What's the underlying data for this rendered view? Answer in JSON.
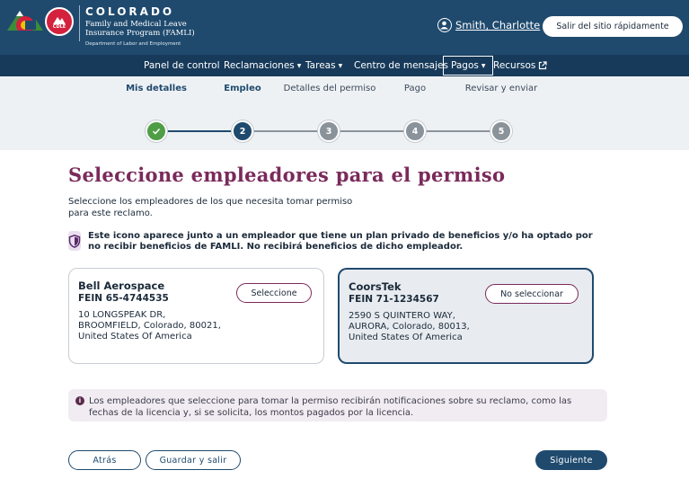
{
  "header": {
    "state_name": "COLORADO",
    "program_line1": "Family and Medical Leave",
    "program_line2": "Insurance Program (FAMLI)",
    "department": "Department of Labor and Employment",
    "seal_text": "CDLE",
    "user_name": "Smith, Charlotte",
    "quick_exit_label": "Salir del sitio rápidamente"
  },
  "nav": {
    "items": [
      {
        "label": "Panel de control",
        "has_dropdown": false
      },
      {
        "label": "Reclamaciones",
        "has_dropdown": true
      },
      {
        "label": "Tareas",
        "has_dropdown": true
      },
      {
        "label": "Centro de mensajes",
        "has_dropdown": false
      },
      {
        "label": "Pagos",
        "has_dropdown": true,
        "active": true
      },
      {
        "label": "Recursos",
        "has_dropdown": false,
        "external": true
      }
    ]
  },
  "stepper": {
    "steps": [
      {
        "label": "Mis detalles",
        "state": "done",
        "number": "1"
      },
      {
        "label": "Empleo",
        "state": "current",
        "number": "2"
      },
      {
        "label": "Detalles del permiso",
        "state": "pending",
        "number": "3"
      },
      {
        "label": "Pago",
        "state": "pending",
        "number": "4"
      },
      {
        "label": "Revisar y enviar",
        "state": "pending",
        "number": "5"
      }
    ]
  },
  "main": {
    "title": "Seleccione empleadores para el permiso",
    "intro": "Seleccione los empleadores de los que necesita tomar permiso para este reclamo.",
    "privacy_note": "Este icono aparece junto a un empleador que tiene un plan privado de beneficios y/o ha optado por no recibir beneficios de FAMLI. No recibirá beneficios de dicho empleador."
  },
  "employers": [
    {
      "name": "Bell Aerospace",
      "fein": "FEIN 65-4744535",
      "address": "10 LONGSPEAK DR, BROOMFIELD, Colorado, 80021, United States Of America",
      "button_label": "Seleccione",
      "selected": false
    },
    {
      "name": "CoorsTek",
      "fein": "FEIN 71-1234567",
      "address": "2590 S QUINTERO WAY, AURORA, Colorado, 80013, United States Of America",
      "button_label": "No seleccionar",
      "selected": true
    }
  ],
  "info": {
    "text": "Los empleadores que seleccione para tomar la permiso recibirán notificaciones sobre su reclamo, como las fechas de la licencia y, si se solicita, los montos pagados por la licencia."
  },
  "footer": {
    "back_label": "Atrás",
    "save_label": "Guardar y salir",
    "next_label": "Siguiente"
  },
  "colors": {
    "header_bg": "#1f4a6e",
    "nav_bg": "#173a5a",
    "title_color": "#7a2a5b",
    "done_step": "#4f9e46"
  }
}
